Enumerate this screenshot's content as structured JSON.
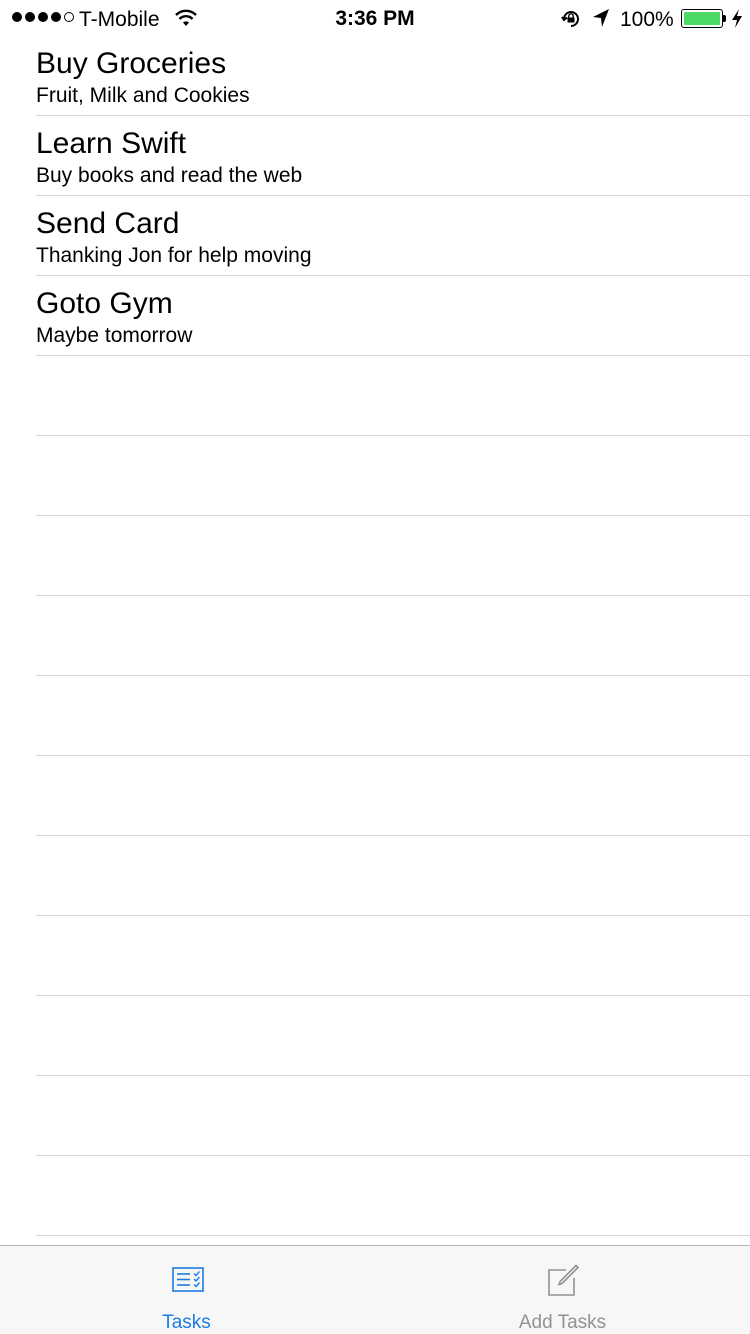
{
  "status_bar": {
    "carrier": "T-Mobile",
    "time": "3:36 PM",
    "battery_percent": "100%",
    "signal_bars_filled": 4,
    "signal_bars_total": 5,
    "battery_color": "#4cd964"
  },
  "tasks": [
    {
      "title": "Buy Groceries",
      "subtitle": "Fruit, Milk and Cookies"
    },
    {
      "title": "Learn Swift",
      "subtitle": "Buy books and read the web"
    },
    {
      "title": "Send Card",
      "subtitle": "Thanking Jon for help moving"
    },
    {
      "title": "Goto Gym",
      "subtitle": "Maybe tomorrow"
    }
  ],
  "tab_bar": {
    "tabs": [
      {
        "label": "Tasks",
        "icon": "checklist-icon",
        "selected": true
      },
      {
        "label": "Add Tasks",
        "icon": "compose-icon",
        "selected": false
      }
    ],
    "active_color": "#1c7ce3",
    "inactive_color": "#929292"
  }
}
